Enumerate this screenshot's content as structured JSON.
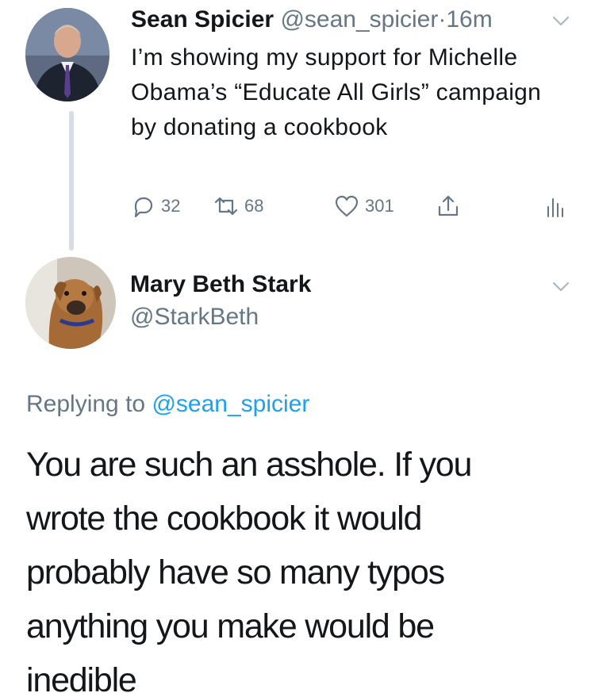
{
  "original_tweet": {
    "author_name": "Sean Spicier",
    "author_handle": "@sean_spicier",
    "separator": "·",
    "time": "16m",
    "text": "I’m showing my support for Michelle Obama’s “Educate All Girls” campaign by donating a cookbook",
    "actions": {
      "reply_count": "32",
      "retweet_count": "68",
      "like_count": "301"
    },
    "icons": [
      "chevron-down-icon",
      "reply-icon",
      "retweet-icon",
      "heart-icon",
      "share-icon",
      "analytics-icon"
    ]
  },
  "reply_tweet": {
    "author_name": "Mary Beth Stark",
    "author_handle": "@StarkBeth",
    "replying_prefix": "Replying to",
    "replying_to": "@sean_spicier",
    "text": "You are such an asshole. If you wrote the cookbook it would probably have so many typos anything you make would be inedible"
  },
  "colors": {
    "text": "#14171a",
    "secondary": "#657786",
    "accent": "#1da1f2",
    "thread_line": "#d7dde2"
  }
}
